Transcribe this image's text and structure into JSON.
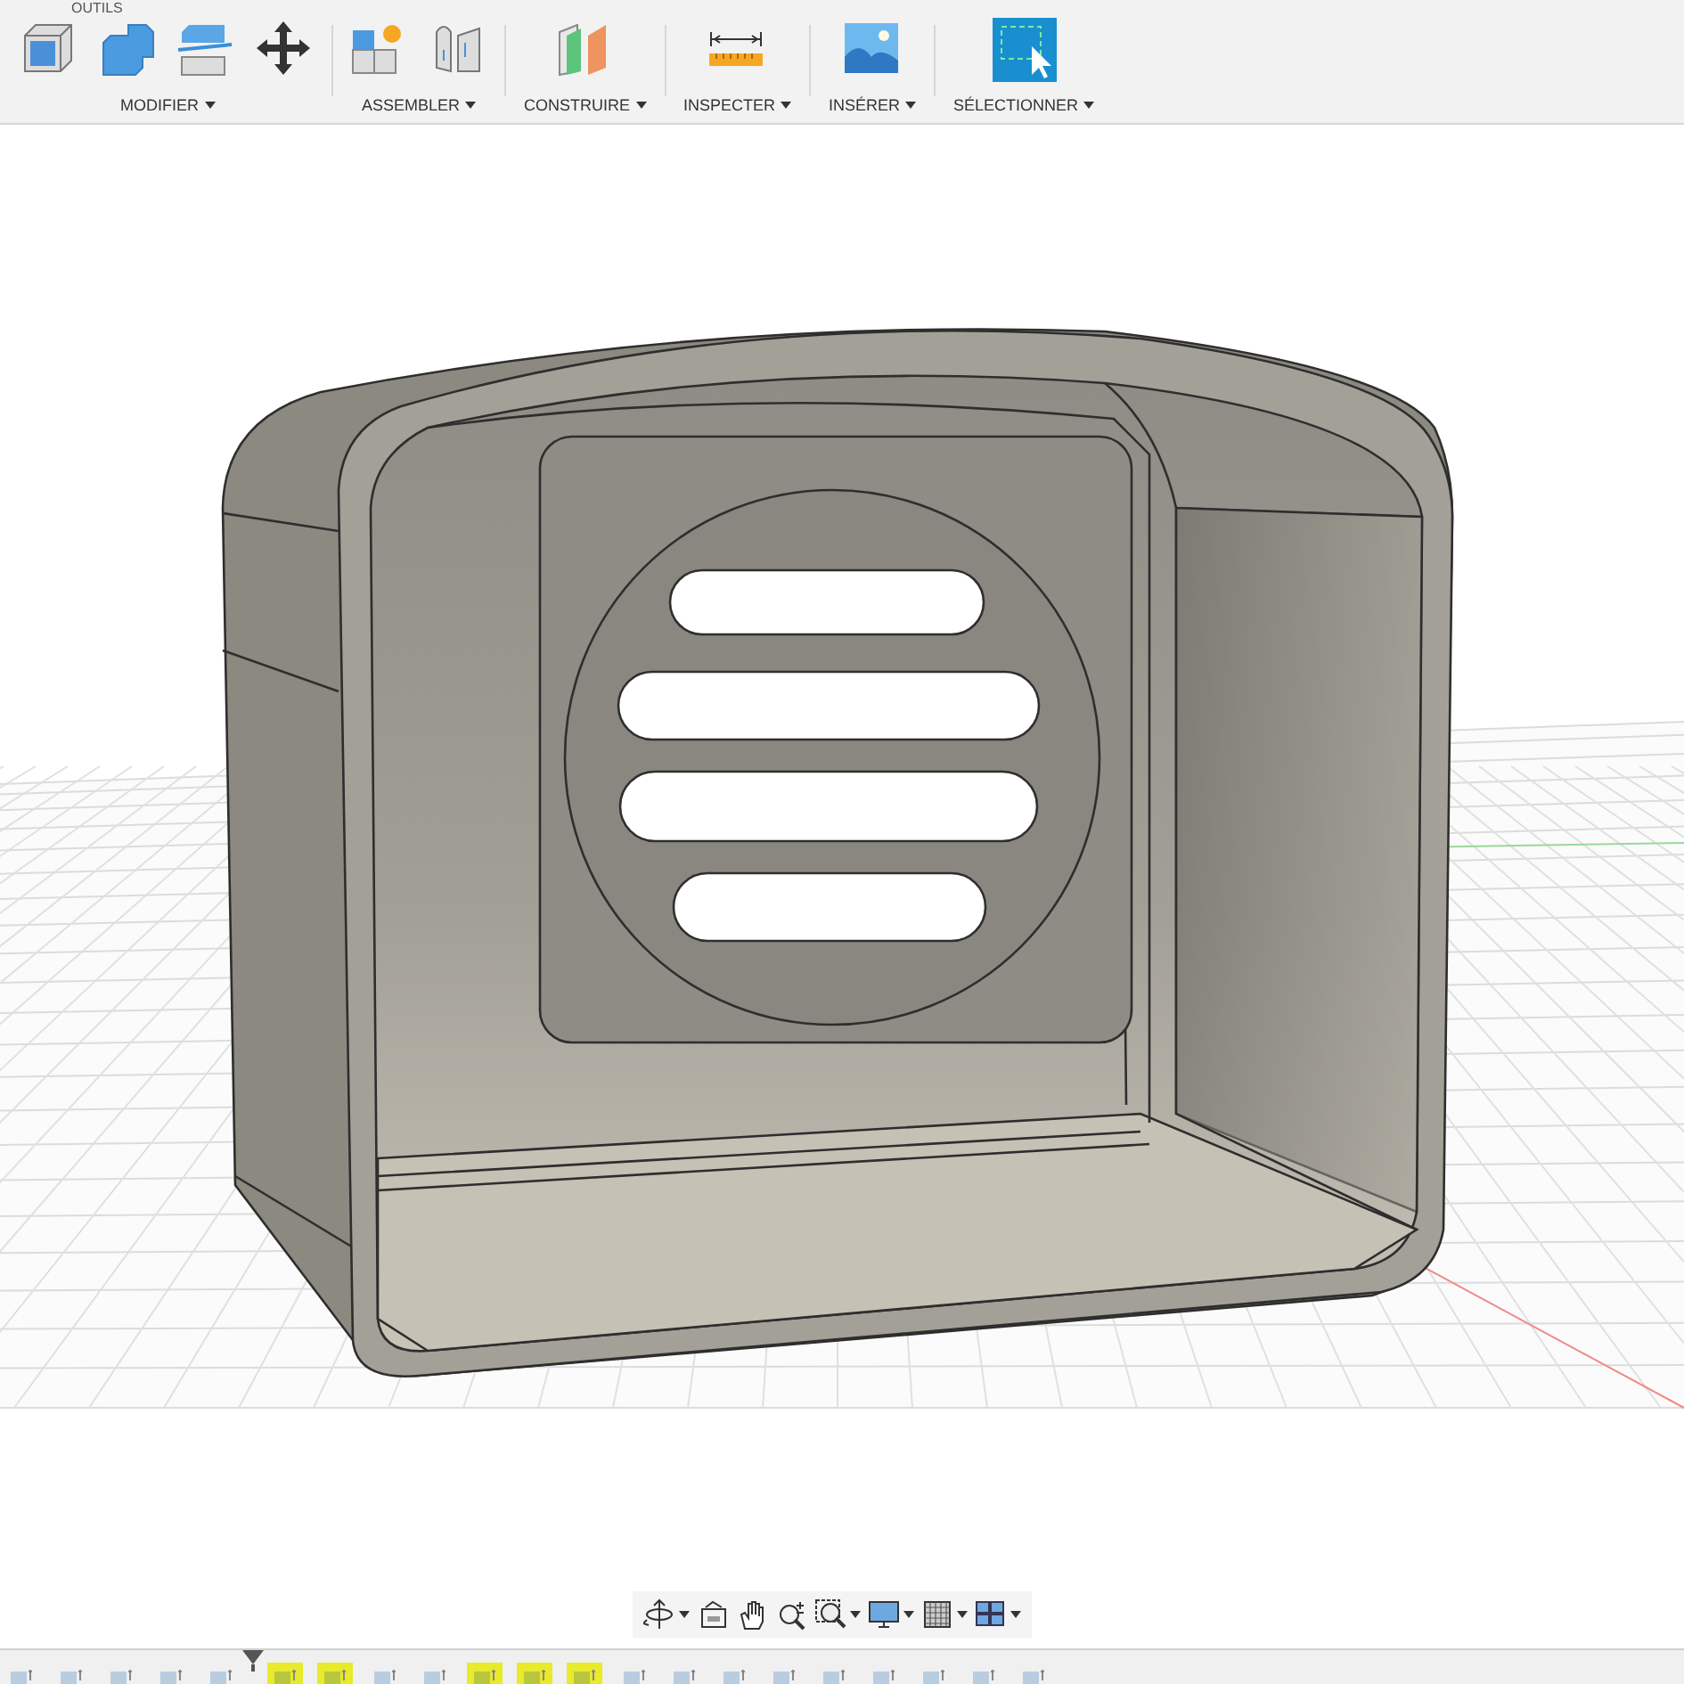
{
  "toolbar": {
    "tab_title": "OUTILS",
    "groups": [
      {
        "label": "MODIFIER"
      },
      {
        "label": "ASSEMBLER"
      },
      {
        "label": "CONSTRUIRE"
      },
      {
        "label": "INSPECTER"
      },
      {
        "label": "INSÉRER"
      },
      {
        "label": "SÉLECTIONNER"
      }
    ]
  },
  "timeline": {
    "items": [
      {
        "highlighted": false
      },
      {
        "highlighted": false
      },
      {
        "highlighted": false
      },
      {
        "highlighted": false
      },
      {
        "highlighted": false
      },
      {
        "highlighted": true
      },
      {
        "highlighted": true
      },
      {
        "highlighted": false
      },
      {
        "highlighted": false
      },
      {
        "highlighted": true
      },
      {
        "highlighted": true
      },
      {
        "highlighted": true
      },
      {
        "highlighted": false
      },
      {
        "highlighted": false
      },
      {
        "highlighted": false
      },
      {
        "highlighted": false
      },
      {
        "highlighted": false
      },
      {
        "highlighted": false
      },
      {
        "highlighted": false
      },
      {
        "highlighted": false
      },
      {
        "highlighted": false
      }
    ]
  }
}
